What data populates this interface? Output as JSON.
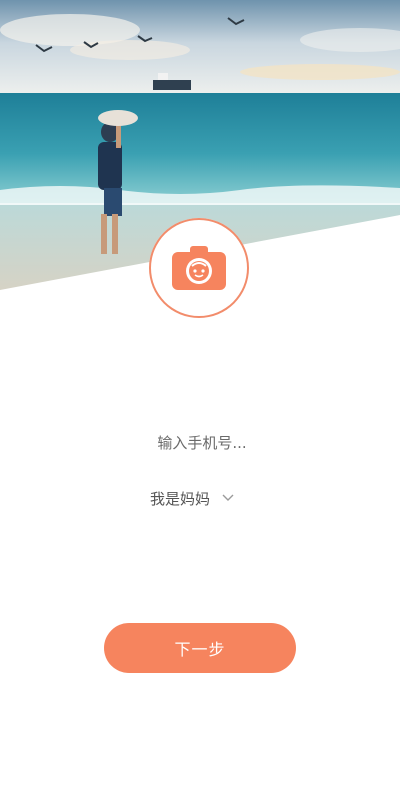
{
  "form": {
    "phone_placeholder": "输入手机号...",
    "role_selected": "我是妈妈",
    "next_label": "下一步"
  },
  "colors": {
    "accent": "#f6845e",
    "logo_ring": "#f28c6b",
    "sky": "#dde6ee",
    "sea": "#2f8fa3"
  },
  "icons": {
    "logo": "camera-baby-icon",
    "dropdown": "chevron-down-icon"
  }
}
